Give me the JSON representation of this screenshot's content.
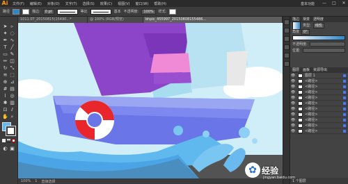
{
  "app": {
    "logo": "Ai"
  },
  "menu": [
    "文件(F)",
    "编辑(E)",
    "对象(O)",
    "文字(T)",
    "选择(S)",
    "效果(C)",
    "视图(V)",
    "窗口(W)",
    "帮助(H)"
  ],
  "menu_right": {
    "workspace": "基本功能",
    "min": "—",
    "max": "□",
    "close": "✕"
  },
  "control_bar": {
    "selection_label": "路径",
    "fill_color": "#2f86c9",
    "stroke_label": "描边:",
    "stroke_value": "0 pt",
    "profile_label": "等比",
    "brush_label": "基本",
    "opacity_label": "不透明度:",
    "opacity_value": "100%",
    "style_label": "样式:"
  },
  "tabs": [
    {
      "label": "1011.0T_20150815(15490...*",
      "active": false
    },
    {
      "label": "@ 100%  (RGB/预览)",
      "active": false
    },
    {
      "label": "bhpic_455997_20150808155486...",
      "active": true
    }
  ],
  "status": {
    "zoom": "100%",
    "page": "1",
    "tool": "直接选择"
  },
  "panel": {
    "tabs": [
      "描边",
      "渐变",
      "透明度"
    ],
    "type_label": "类型:",
    "type_value": "线性",
    "angle_label": "角度",
    "angle_value": "0°",
    "opacity_label": "不透明度:",
    "location_label": "位置:",
    "layers_tabs": [
      "图层",
      "画板",
      "资源导出"
    ],
    "layers": [
      {
        "name": "图层 1",
        "color": "#3d7bff"
      },
      {
        "name": "<路径>",
        "color": "#3d7bff"
      },
      {
        "name": "<路径>",
        "color": "#3d7bff"
      },
      {
        "name": "<路径>",
        "color": "#3d7bff"
      },
      {
        "name": "<路径>",
        "color": "#3d7bff"
      },
      {
        "name": "<路径>",
        "color": "#3d7bff"
      },
      {
        "name": "<路径>",
        "color": "#3d7bff"
      },
      {
        "name": "<路径>",
        "color": "#3d7bff"
      },
      {
        "name": "<路径>",
        "color": "#3d7bff"
      },
      {
        "name": "<路径>",
        "color": "#3d7bff"
      },
      {
        "name": "<路径>",
        "color": "#3d7bff"
      }
    ],
    "layers_count": "1 个图层"
  },
  "watermark": {
    "text": "经验",
    "url": "jingyan.baidu.com"
  },
  "colors": {
    "sky": "#cfeef7",
    "sail_purple": "#8c45c8",
    "sail_pink": "#f08ad6",
    "hull_blue": "#6a76e8",
    "wave": "#5fb8ee",
    "ring_red": "#e8262b"
  },
  "icons": [
    "selection-tool-icon",
    "direct-selection-icon",
    "pen-icon",
    "type-icon",
    "line-icon",
    "rectangle-icon",
    "brush-icon",
    "pencil-icon",
    "eraser-icon",
    "rotate-icon",
    "scale-icon",
    "warp-icon",
    "free-transform-icon",
    "shape-builder-icon",
    "mesh-icon",
    "gradient-icon",
    "eyedropper-icon",
    "blend-icon",
    "symbol-sprayer-icon",
    "graph-icon",
    "artboard-icon",
    "slice-icon",
    "hand-icon",
    "zoom-icon"
  ]
}
